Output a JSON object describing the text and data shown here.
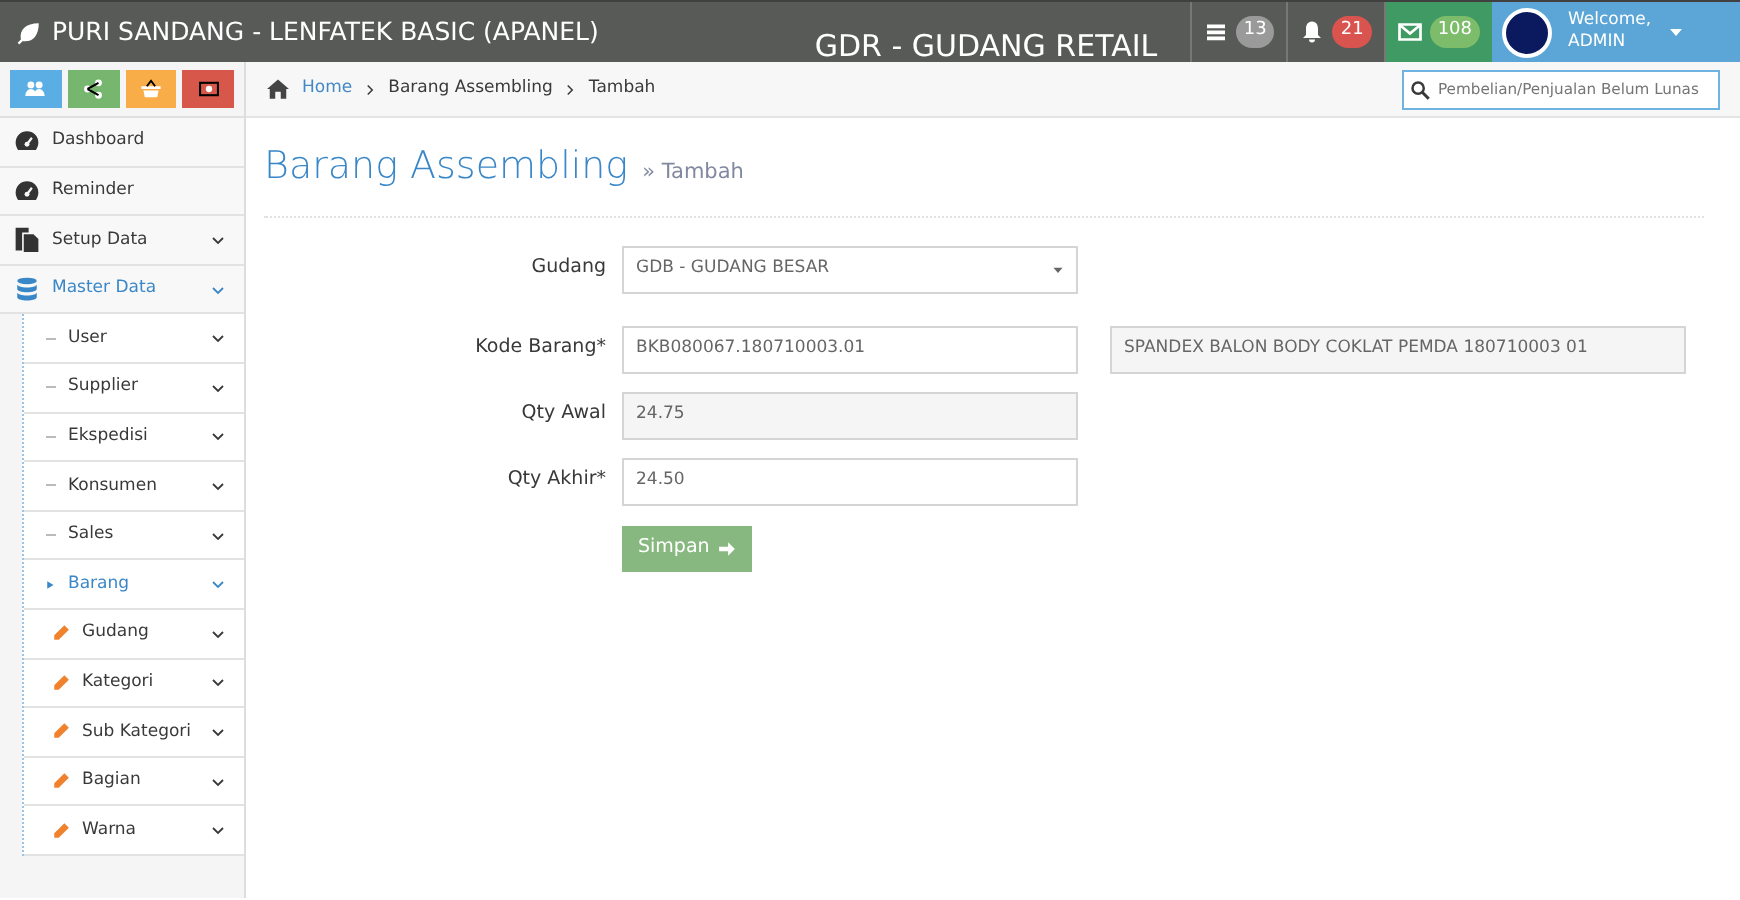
{
  "brand": {
    "title": "PURI SANDANG - LENFATEK BASIC (APANEL)"
  },
  "store": "GDR - GUDANG RETAIL",
  "notifications": [
    {
      "kind": "tasks",
      "count": "13"
    },
    {
      "kind": "bell",
      "count": "21"
    },
    {
      "kind": "mail",
      "count": "108"
    }
  ],
  "user": {
    "greeting": "Welcome,",
    "name": "ADMIN"
  },
  "shortcuts": [
    {
      "kind": "users",
      "color": "#5aaee3"
    },
    {
      "kind": "share",
      "color": "#77b66e"
    },
    {
      "kind": "basket",
      "color": "#f8ad48"
    },
    {
      "kind": "money",
      "color": "#d7574a"
    }
  ],
  "breadcrumb": [
    "Home",
    "Barang Assembling",
    "Tambah"
  ],
  "search": {
    "placeholder": "Pembelian/Penjualan Belum Lunas"
  },
  "sidebar": {
    "items": [
      {
        "label": "Dashboard",
        "selected": false,
        "expandable": false
      },
      {
        "label": "Reminder",
        "selected": false,
        "expandable": false
      },
      {
        "label": "Setup Data",
        "selected": false,
        "expandable": true
      },
      {
        "label": "Master Data",
        "selected": true,
        "expandable": true,
        "children": [
          {
            "label": "User",
            "selected": false,
            "expandable": true
          },
          {
            "label": "Supplier",
            "selected": false,
            "expandable": true
          },
          {
            "label": "Ekspedisi",
            "selected": false,
            "expandable": true
          },
          {
            "label": "Konsumen",
            "selected": false,
            "expandable": true
          },
          {
            "label": "Sales",
            "selected": false,
            "expandable": true
          },
          {
            "label": "Barang",
            "selected": true,
            "expandable": true,
            "children": [
              {
                "label": "Gudang",
                "selected": false,
                "expandable": true
              },
              {
                "label": "Kategori",
                "selected": false,
                "expandable": true
              },
              {
                "label": "Sub Kategori",
                "selected": false,
                "expandable": true
              },
              {
                "label": "Bagian",
                "selected": false,
                "expandable": true
              },
              {
                "label": "Warna",
                "selected": false,
                "expandable": true
              }
            ]
          }
        ]
      }
    ]
  },
  "page": {
    "title": "Barang Assembling",
    "subtitle": "» Tambah"
  },
  "form": {
    "fields": [
      {
        "kind": "select",
        "label": "Gudang",
        "value": "GDB - GUDANG BESAR"
      },
      {
        "kind": "text",
        "label": "Kode Barang*",
        "value": "BKB080067.180710003.01",
        "description": "SPANDEX BALON BODY COKLAT PEMDA 180710003 01"
      },
      {
        "kind": "readonly",
        "label": "Qty Awal",
        "value": "24.75"
      },
      {
        "kind": "text",
        "label": "Qty Akhir*",
        "value": "24.50"
      }
    ],
    "submit": "Simpan"
  }
}
